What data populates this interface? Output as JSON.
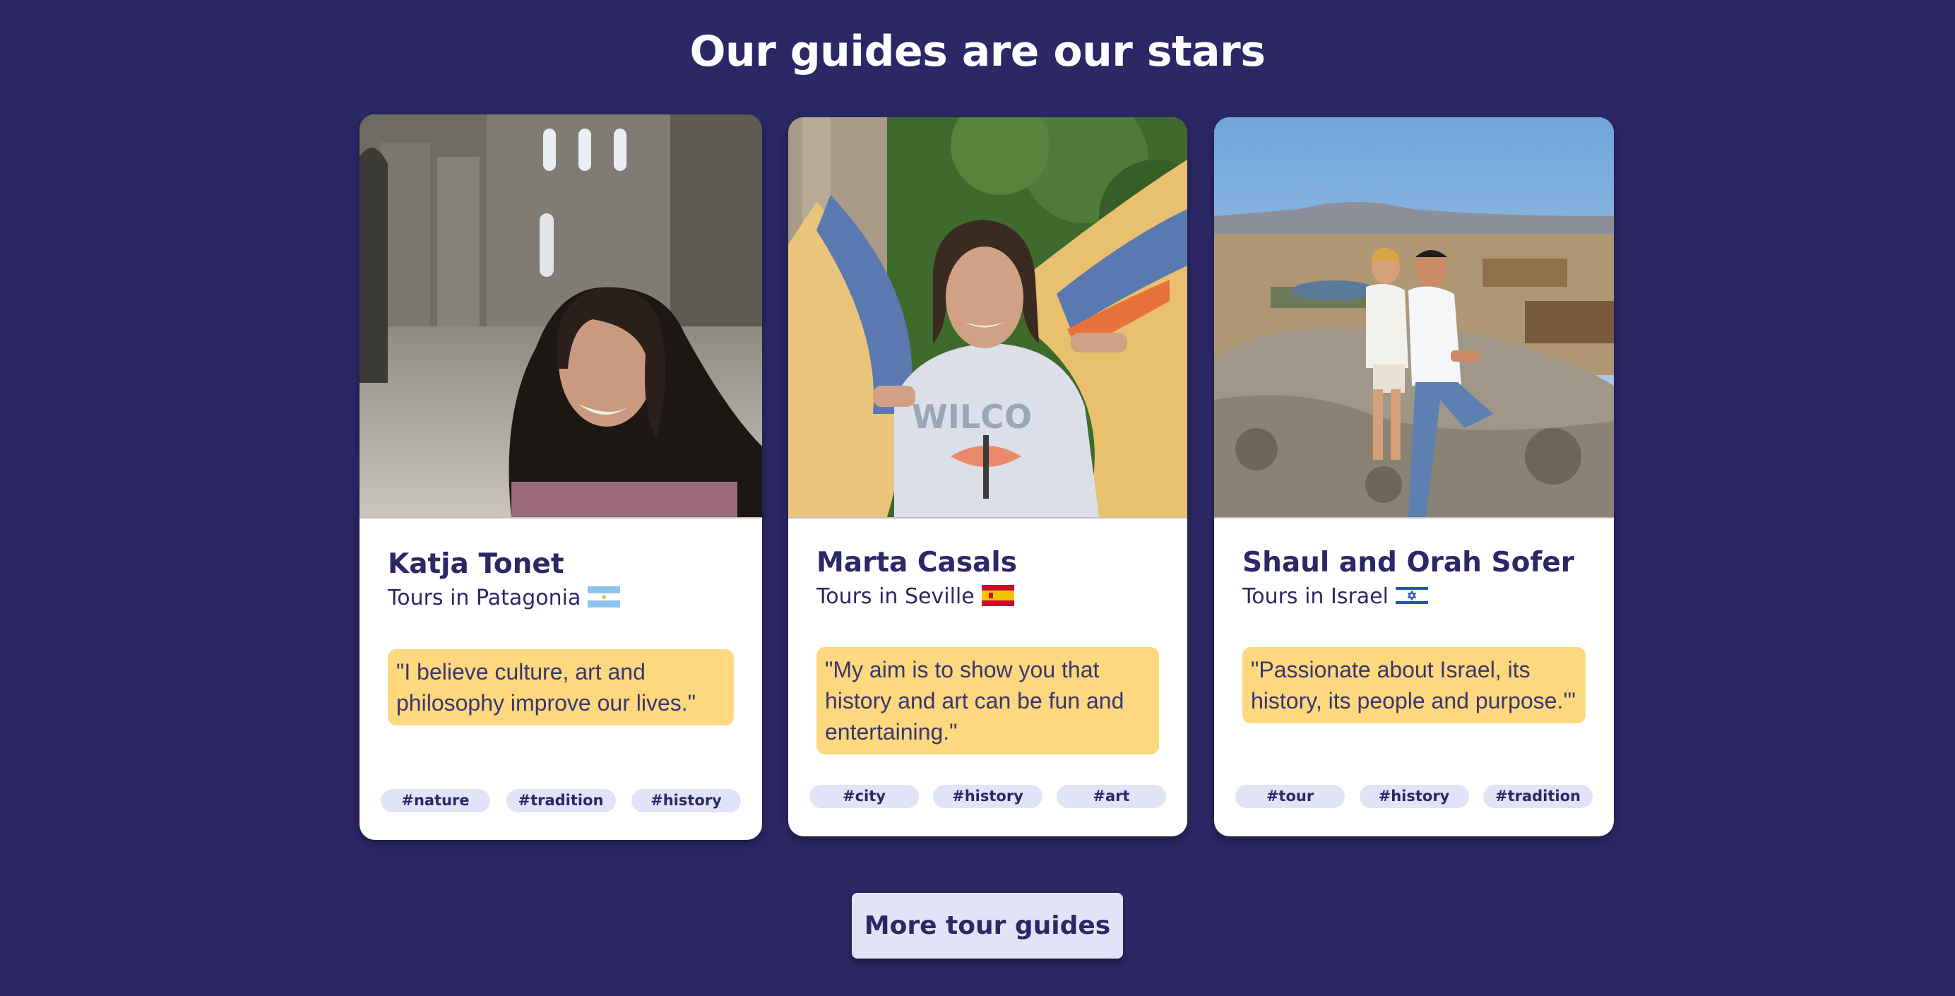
{
  "section": {
    "title": "Our guides are our stars"
  },
  "guides": [
    {
      "name": "Katja Tonet",
      "location": "Tours in Patagonia",
      "flag": "argentina-flag-icon",
      "quote": "\"I believe culture, art and philosophy improve our lives.\"",
      "tags": [
        "#nature",
        "#tradition",
        "#history"
      ]
    },
    {
      "name": "Marta Casals",
      "location": "Tours in Seville",
      "flag": "spain-flag-icon",
      "quote": "\"My aim is to show you that history and art can be fun and entertaining.\"",
      "tags": [
        "#city",
        "#history",
        "#art"
      ]
    },
    {
      "name": "Shaul and Orah Sofer",
      "location": "Tours in Israel",
      "flag": "israel-flag-icon",
      "quote": "\"Passionate about Israel, its history, its people and purpose.'\"",
      "tags": [
        "#tour",
        "#history",
        "#tradition"
      ]
    }
  ],
  "actions": {
    "more_guides_label": "More tour guides"
  },
  "colors": {
    "background": "#2c2866",
    "card": "#ffffff",
    "quote_highlight": "#fdd87e",
    "tag_pill": "#e3e3f8",
    "text_primary": "#2c2866"
  }
}
